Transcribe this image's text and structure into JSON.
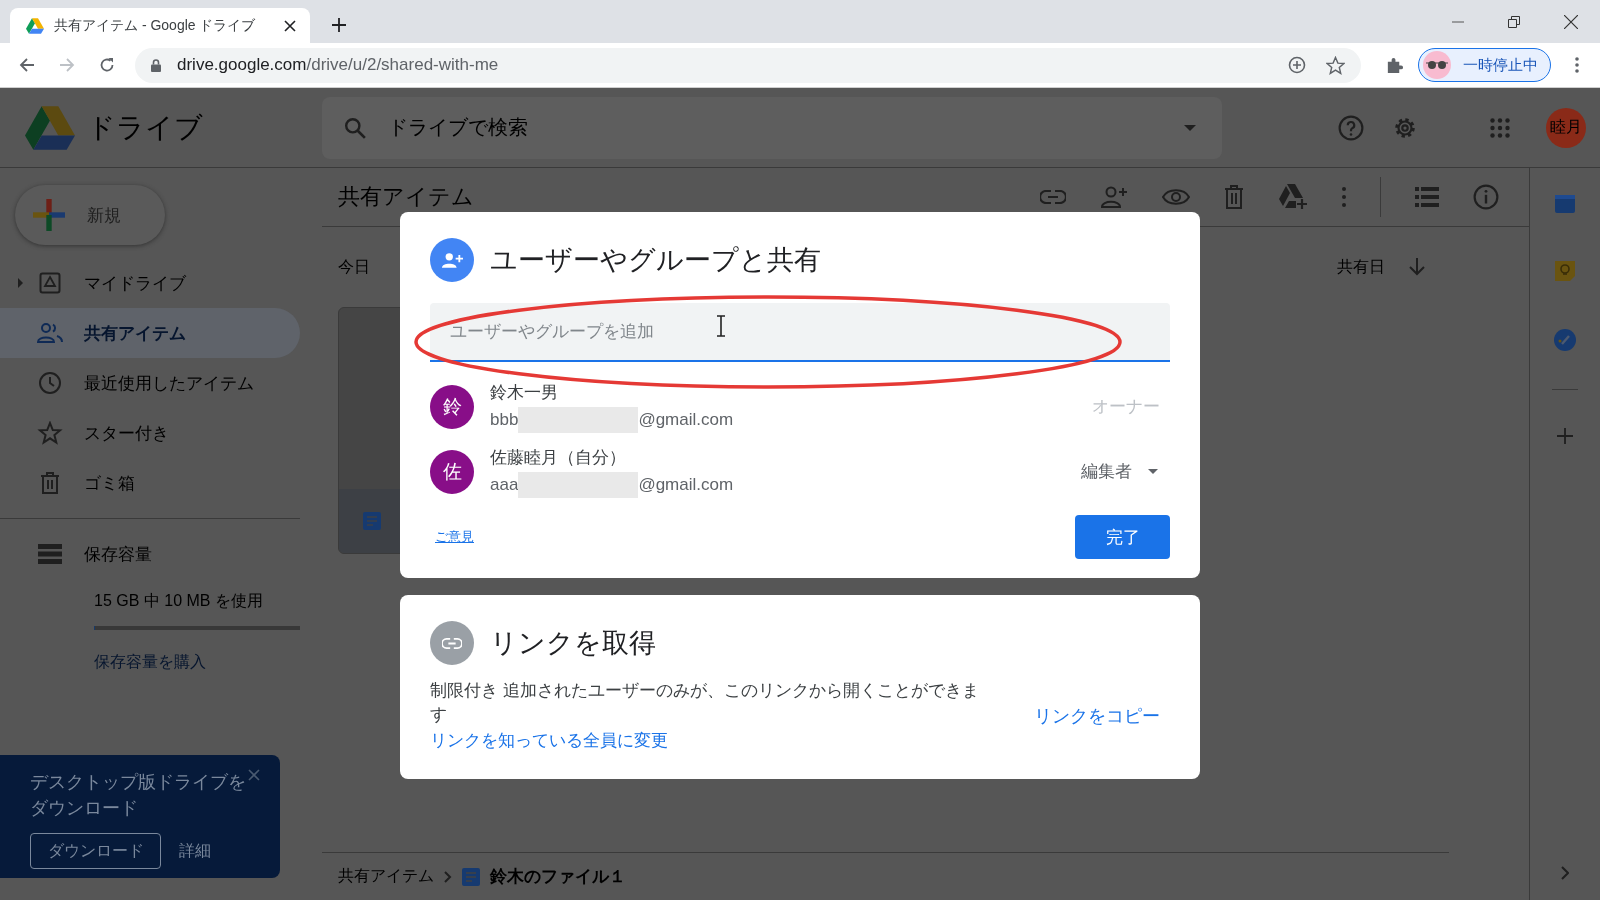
{
  "browser": {
    "tab": {
      "title": "共有アイテム - Google ドライブ",
      "selected": true
    },
    "url_host": "drive.google.com",
    "url_path": "/drive/u/2/shared-with-me",
    "profile": {
      "label": "一時停止中"
    }
  },
  "header": {
    "app_name": "ドライブ",
    "search": {
      "placeholder": "ドライブで検索"
    },
    "avatar": "睦月"
  },
  "sidebar": {
    "new_button": "新規",
    "items": [
      {
        "label": "マイドライブ",
        "kind": "drive",
        "expandable": true,
        "selected": false
      },
      {
        "label": "共有アイテム",
        "kind": "shared",
        "expandable": false,
        "selected": true
      },
      {
        "label": "最近使用したアイテム",
        "kind": "recent",
        "expandable": false,
        "selected": false
      },
      {
        "label": "スター付き",
        "kind": "starred",
        "expandable": false,
        "selected": false
      },
      {
        "label": "ゴミ箱",
        "kind": "trash",
        "expandable": false,
        "selected": false
      }
    ],
    "storage": {
      "label": "保存容量",
      "usage": "15 GB 中 10 MB を使用",
      "level": 0.001,
      "buy": "保存容量を購入"
    },
    "promo": {
      "text": "デスクトップ版ドライブをダウンロード",
      "download": "ダウンロード",
      "details": "詳細"
    }
  },
  "main": {
    "title": "共有アイテム",
    "section": "今日",
    "sort_label": "共有日"
  },
  "breadcrumb": {
    "parent": "共有アイテム",
    "file": "鈴木のファイル１"
  },
  "share_dialog": {
    "title": "ユーザーやグループと共有",
    "input": {
      "placeholder": "ユーザーやグループを追加"
    },
    "people": [
      {
        "initial": "鈴",
        "name": "鈴木一男",
        "email_start": "bbb",
        "email_end": "@gmail.com",
        "role": "オーナー",
        "kind": "fixed"
      },
      {
        "initial": "佐",
        "name": "佐藤睦月（自分）",
        "email_start": "aaa",
        "email_end": "@gmail.com",
        "role": "編集者",
        "kind": "dropdown"
      }
    ],
    "feedback": "ご意見",
    "done": "完了"
  },
  "link_dialog": {
    "title": "リンクを取得",
    "description": "制限付き 追加されたユーザーのみが、このリンクから開くことができます",
    "change_link": "リンクを知っている全員に変更",
    "copy_link": "リンクをコピー"
  }
}
